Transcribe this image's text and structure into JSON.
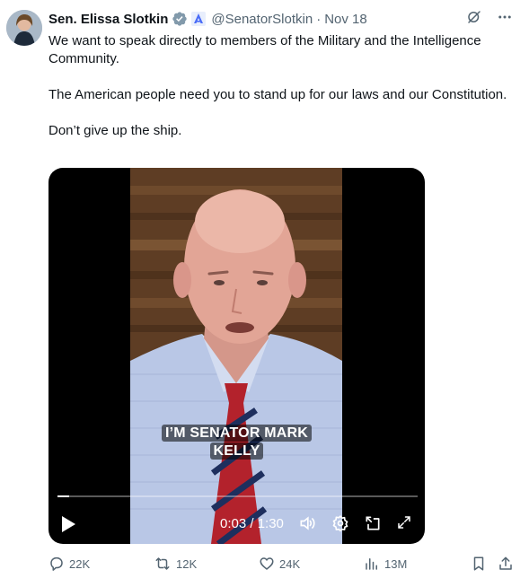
{
  "author": {
    "name": "Sen. Elissa Slotkin",
    "handle": "@SenatorSlotkin",
    "separator": "·",
    "date": "Nov 18",
    "verified": true
  },
  "tweet": {
    "paragraphs": [
      "We want to speak directly to members of the Military and the Intelligence Community.",
      "The American people need you to stand up for our laws and our Constitution.",
      "Don’t give up the ship."
    ]
  },
  "video": {
    "caption_line1": "I’M SENATOR MARK",
    "caption_line2": "KELLY",
    "current_time": "0:03",
    "duration": "1:30",
    "time_display": "0:03 / 1:30",
    "progress_fraction": 0.033
  },
  "actions": {
    "replies": "22K",
    "reposts": "12K",
    "likes": "24K",
    "views": "13M"
  },
  "icons": {
    "verified": "verified-badge-icon",
    "affiliate": "government-affiliate-icon",
    "grok": "grok-icon",
    "more": "more-icon",
    "reply": "reply-icon",
    "repost": "repost-icon",
    "like": "like-icon",
    "views": "views-icon",
    "bookmark": "bookmark-icon",
    "share": "share-icon"
  },
  "colors": {
    "text": "#0f1419",
    "secondary": "#536471",
    "verified_gray": "#829aab",
    "affiliate_blue": "#4a6cf7"
  }
}
